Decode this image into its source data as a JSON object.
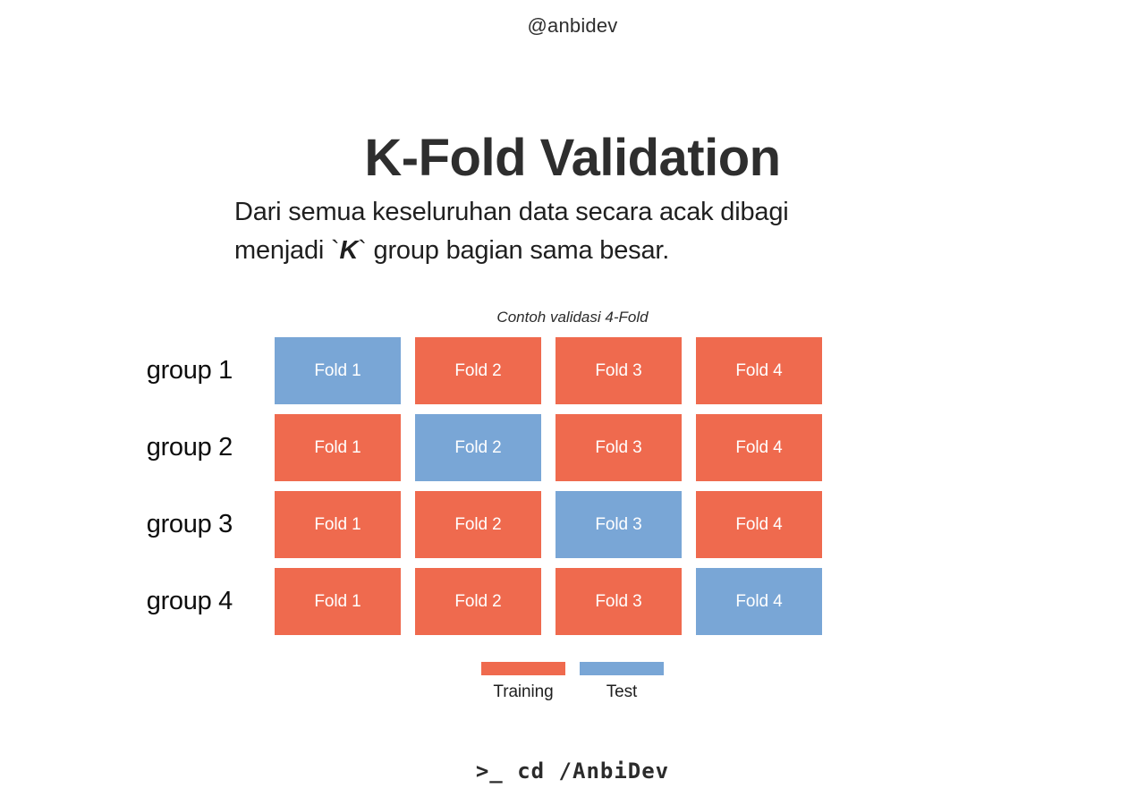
{
  "header": {
    "handle": "@anbidev",
    "title": "K-Fold Validation"
  },
  "description": {
    "line1_before": "Dari semua keseluruhan data secara acak  dibagi",
    "line2_before": "menjadi `",
    "highlight": "K",
    "line2_after": "` group bagian sama besar."
  },
  "diagram": {
    "caption": "Contoh validasi 4-Fold",
    "rows": [
      {
        "label": "group 1",
        "cells": [
          {
            "text": "Fold 1",
            "role": "test"
          },
          {
            "text": "Fold 2",
            "role": "training"
          },
          {
            "text": "Fold 3",
            "role": "training"
          },
          {
            "text": "Fold 4",
            "role": "training"
          }
        ]
      },
      {
        "label": "group 2",
        "cells": [
          {
            "text": "Fold 1",
            "role": "training"
          },
          {
            "text": "Fold 2",
            "role": "test"
          },
          {
            "text": "Fold 3",
            "role": "training"
          },
          {
            "text": "Fold 4",
            "role": "training"
          }
        ]
      },
      {
        "label": "group 3",
        "cells": [
          {
            "text": "Fold 1",
            "role": "training"
          },
          {
            "text": "Fold 2",
            "role": "training"
          },
          {
            "text": "Fold 3",
            "role": "test"
          },
          {
            "text": "Fold 4",
            "role": "training"
          }
        ]
      },
      {
        "label": "group 4",
        "cells": [
          {
            "text": "Fold 1",
            "role": "training"
          },
          {
            "text": "Fold 2",
            "role": "training"
          },
          {
            "text": "Fold 3",
            "role": "training"
          },
          {
            "text": "Fold 4",
            "role": "test"
          }
        ]
      }
    ]
  },
  "legend": {
    "items": [
      {
        "label": "Training",
        "role": "training"
      },
      {
        "label": "Test",
        "role": "test"
      }
    ]
  },
  "footer": {
    "terminal": ">_ cd /AnbiDev"
  },
  "colors": {
    "training": "#ef6a4e",
    "test": "#79a6d6",
    "background": "#ffffff",
    "text": "#2b2b2b"
  }
}
